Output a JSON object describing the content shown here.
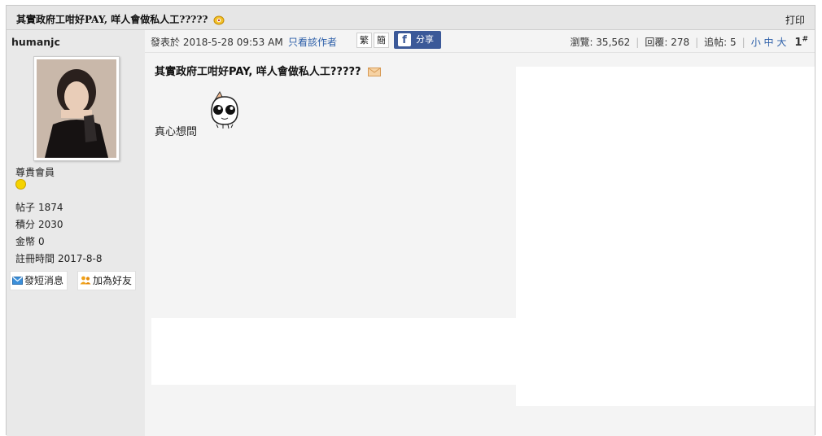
{
  "thread": {
    "title": "其實政府工咁好PAY, 咩人會做私人工?????",
    "print_label": "打印"
  },
  "author": {
    "name": "humanjc",
    "rank": "尊貴會員",
    "stats": [
      {
        "label": "帖子",
        "value": "1874"
      },
      {
        "label": "積分",
        "value": "2030"
      },
      {
        "label": "金幣",
        "value": "0"
      },
      {
        "label": "註冊時間",
        "value": "2017-8-8"
      }
    ],
    "pm_button": "發短消息",
    "add_friend_button": "加為好友"
  },
  "meta": {
    "posted": "發表於 2018-5-28 09:53 AM",
    "only_author": "只看該作者",
    "trad_btn": "繁",
    "simp_btn": "簡",
    "share_label": "分享",
    "views": "瀏覽: 35,562",
    "replies": "回覆: 278",
    "follows": "追帖: 5",
    "font_small": "小",
    "font_mid": "中",
    "font_large": "大",
    "floor": "1",
    "floor_sup": "#"
  },
  "post": {
    "title": "其實政府工咁好PAY, 咩人會做私人工?????",
    "body": "真心想問"
  },
  "colors": {
    "link": "#2b5ea8",
    "facebook": "#3b5998",
    "sidebar": "#e9e9e9",
    "content_bg": "#f4f4f4"
  }
}
